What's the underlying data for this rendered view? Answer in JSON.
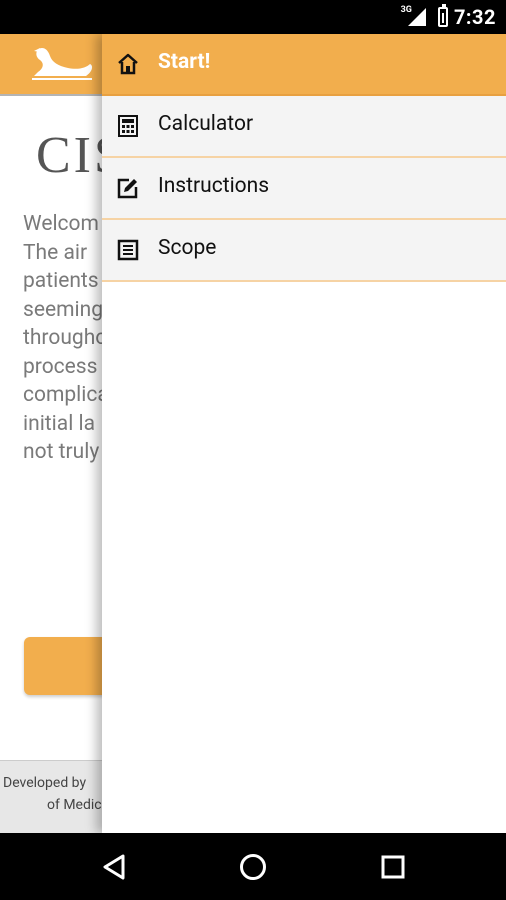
{
  "status_bar": {
    "network": "3G",
    "time": "7:32"
  },
  "app": {
    "title_partial": "CIS",
    "intro_lines": [
      "Welcom",
      "The  air",
      "patients",
      "seeming",
      "througho",
      "process",
      "complica",
      "initial  la",
      "not truly"
    ],
    "footer": {
      "line1": "Developed by",
      "line2": "of Medic"
    }
  },
  "drawer": {
    "items": [
      {
        "label": "Start!",
        "icon": "home-icon",
        "active": true
      },
      {
        "label": "Calculator",
        "icon": "calculator-icon",
        "active": false
      },
      {
        "label": "Instructions",
        "icon": "edit-icon",
        "active": false
      },
      {
        "label": "Scope",
        "icon": "document-icon",
        "active": false
      }
    ]
  },
  "colors": {
    "accent": "#f2ae4d",
    "divider": "#f6d3a4"
  },
  "nav_bar": {
    "buttons": [
      "back-icon",
      "home-circle-icon",
      "recents-icon"
    ]
  }
}
